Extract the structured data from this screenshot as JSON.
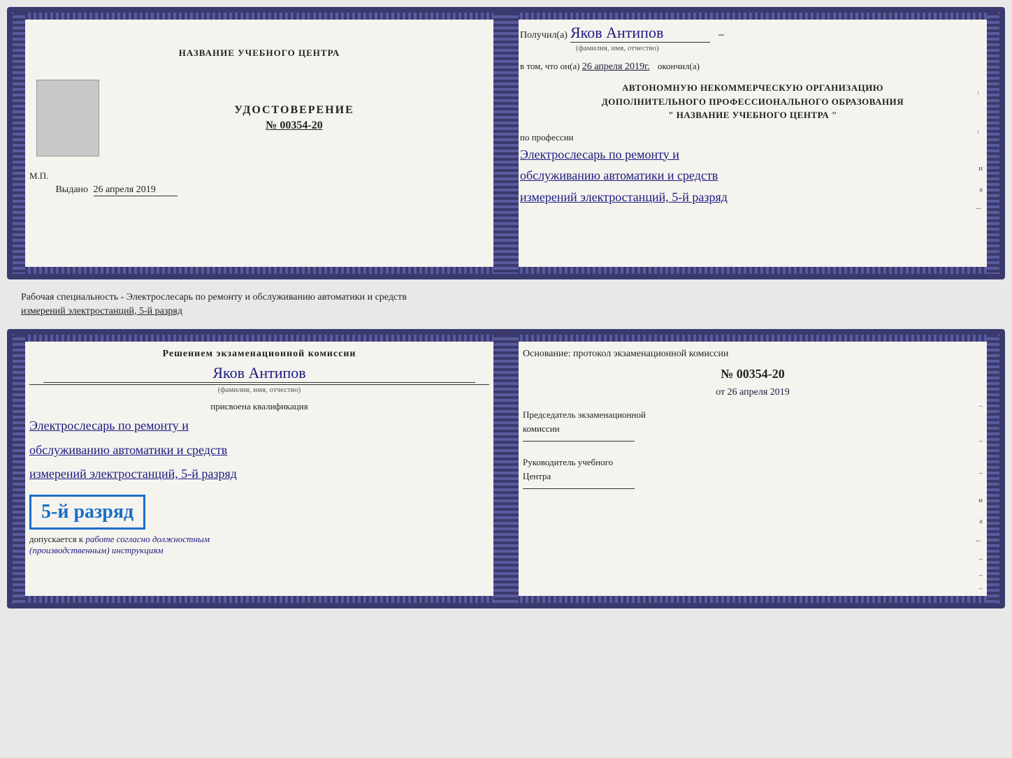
{
  "top_doc": {
    "left": {
      "school_name": "НАЗВАНИЕ УЧЕБНОГО ЦЕНТРА",
      "cert_title": "УДОСТОВЕРЕНИЕ",
      "cert_number": "№ 00354-20",
      "issued_label": "Выдано",
      "issued_date": "26 апреля 2019",
      "mp_label": "М.П."
    },
    "right": {
      "recipient_label": "Получил(а)",
      "recipient_name": "Яков Антипов",
      "fio_label": "(фамилия, имя, отчество)",
      "certified_line": "в том, что он(а)",
      "certified_date": "26 апреля 2019г.",
      "finished_label": "окончил(а)",
      "org_line1": "АВТОНОМНУЮ НЕКОММЕРЧЕСКУЮ ОРГАНИЗАЦИЮ",
      "org_line2": "ДОПОЛНИТЕЛЬНОГО ПРОФЕССИОНАЛЬНОГО ОБРАЗОВАНИЯ",
      "org_line3": "\"  НАЗВАНИЕ УЧЕБНОГО ЦЕНТРА  \"",
      "profession_label": "по профессии",
      "profession_line1": "Электрослесарь по ремонту и",
      "profession_line2": "обслуживанию автоматики и средств",
      "profession_line3": "измерений электростанций, 5-й разряд"
    }
  },
  "middle": {
    "text": "Рабочая специальность - Электрослесарь по ремонту и обслуживанию автоматики и средств",
    "text2": "измерений электростанций, 5-й разряд"
  },
  "bottom_doc": {
    "left": {
      "header": "Решением экзаменационной комиссии",
      "name": "Яков Антипов",
      "fio_label": "(фамилия, имя, отчество)",
      "assigned_label": "присвоена квалификация",
      "profession_line1": "Электрослесарь по ремонту и",
      "profession_line2": "обслуживанию автоматики и средств",
      "profession_line3": "измерений электростанций, 5-й разряд",
      "rank_badge": "5-й разряд",
      "allowed_label": "допускается к",
      "allowed_handwritten": "работе согласно должностным",
      "allowed_handwritten2": "(производственным) инструкциям"
    },
    "right": {
      "basis_label": "Основание: протокол экзаменационной комиссии",
      "protocol_number": "№  00354-20",
      "date_prefix": "от",
      "date": "26 апреля 2019",
      "chairman_title_line1": "Председатель экзаменационной",
      "chairman_title_line2": "комиссии",
      "manager_title_line1": "Руководитель учебного",
      "manager_title_line2": "Центра"
    }
  }
}
